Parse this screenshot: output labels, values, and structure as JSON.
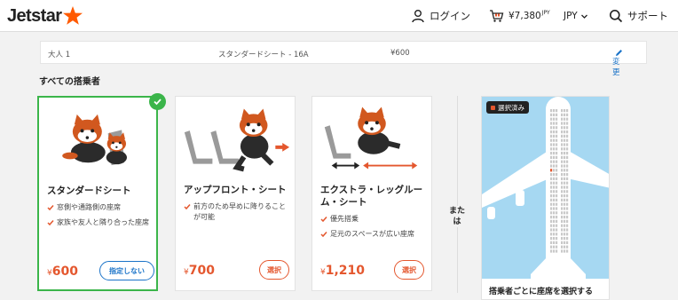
{
  "header": {
    "brand": "Jetstar",
    "login_label": "ログイン",
    "cart_amount": "¥7,380",
    "cart_currency": "JPY",
    "currency_label": "JPY",
    "support_label": "サポート"
  },
  "passenger": {
    "name": "大人 1",
    "seat": "スタンダードシート - 16A",
    "price": "¥600",
    "change_label": "変更"
  },
  "section_title": "すべての搭乗者",
  "seat_options": [
    {
      "title": "スタンダードシート",
      "features": [
        "窓側や通路側の座席",
        "家族や友人と隣り合った座席"
      ],
      "price_symbol": "¥",
      "price_value": "600",
      "button_label": "指定しない",
      "selected": true
    },
    {
      "title": "アップフロント・シート",
      "features": [
        "前方のため早めに降りることが可能"
      ],
      "price_symbol": "¥",
      "price_value": "700",
      "button_label": "選択",
      "selected": false
    },
    {
      "title": "エクストラ・レッグルーム・シート",
      "features": [
        "優先搭乗",
        "足元のスペースが広い座席"
      ],
      "price_symbol": "¥",
      "price_value": "1,210",
      "button_label": "選択",
      "selected": false
    }
  ],
  "or_label": "または",
  "seatmap": {
    "badge": "選択済み",
    "caption": "搭乗者ごとに座席を選択する"
  },
  "colors": {
    "accent": "#e4572e",
    "link": "#1a73c8",
    "selected": "#3bb54a",
    "sky": "#a6d8f2"
  }
}
